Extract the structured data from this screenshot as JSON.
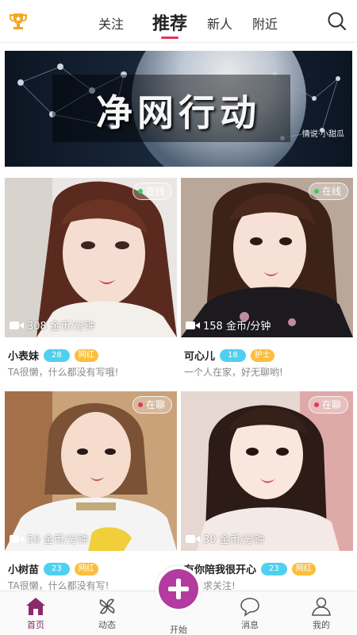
{
  "header": {
    "tabs": [
      {
        "label": "关注"
      },
      {
        "label": "推荐"
      },
      {
        "label": "新人"
      },
      {
        "label": "附近"
      }
    ],
    "active_tab": "推荐",
    "accent_color": "#e7335a"
  },
  "banner": {
    "title": "净网行动",
    "signature": "情说·小甜瓜"
  },
  "cards": [
    {
      "status": "在线",
      "status_color": "#34d058",
      "price": "308 金币/分钟",
      "name": "小表妹",
      "age": "28",
      "tag": "网红",
      "bio": "TA很懒，什么都没有写哦!"
    },
    {
      "status": "在线",
      "status_color": "#34d058",
      "price": "158 金币/分钟",
      "name": "可心儿",
      "age": "18",
      "tag": "护士",
      "bio": "一个人在家，好无聊哟!"
    },
    {
      "status": "在聊",
      "status_color": "#e7335a",
      "price": "50 金币/分钟",
      "name": "小树苗",
      "age": "23",
      "tag": "网红",
      "bio": "TA很懒，什么都没有写!"
    },
    {
      "status": "在聊",
      "status_color": "#e7335a",
      "price": "30 金币/分钟",
      "name": "有你陪我很开心",
      "age": "23",
      "tag": "网红",
      "bio": "人，求关注!"
    }
  ],
  "bottom_nav": {
    "items": [
      {
        "label": "首页",
        "icon": "home-icon"
      },
      {
        "label": "动态",
        "icon": "pinwheel-icon"
      },
      {
        "label": "开始",
        "icon": "plus-icon"
      },
      {
        "label": "消息",
        "icon": "chat-icon"
      },
      {
        "label": "我的",
        "icon": "user-icon"
      }
    ],
    "active": "首页",
    "active_color": "#8a2a6a",
    "fab_color": "#b33a9e"
  }
}
